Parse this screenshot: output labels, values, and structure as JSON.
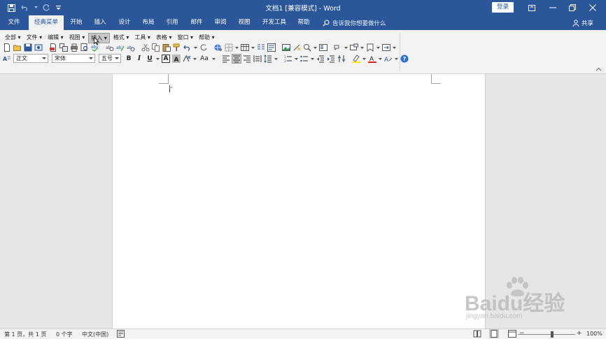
{
  "window": {
    "title": "文档1 [兼容模式] - Word",
    "login_label": "登录"
  },
  "tabs": [
    {
      "label": "文件"
    },
    {
      "label": "经典菜单"
    },
    {
      "label": "开始"
    },
    {
      "label": "插入"
    },
    {
      "label": "设计"
    },
    {
      "label": "布局"
    },
    {
      "label": "引用"
    },
    {
      "label": "邮件"
    },
    {
      "label": "审阅"
    },
    {
      "label": "视图"
    },
    {
      "label": "开发工具"
    },
    {
      "label": "帮助"
    }
  ],
  "tell_me": {
    "placeholder": "告诉我你想要做什么"
  },
  "share_label": "共享",
  "classic_menu": [
    {
      "label": "全部 ▾"
    },
    {
      "label": "文件 ▾"
    },
    {
      "label": "编辑 ▾"
    },
    {
      "label": "视图 ▾"
    },
    {
      "label": "插入 ▾"
    },
    {
      "label": "格式 ▾"
    },
    {
      "label": "工具 ▾"
    },
    {
      "label": "表格 ▾"
    },
    {
      "label": "窗口 ▾"
    },
    {
      "label": "帮助 ▾"
    }
  ],
  "format_bar": {
    "style_value": "正文",
    "font_value": "宋体",
    "size_value": "五号",
    "bold": "B",
    "italic": "I",
    "underline": "U",
    "char_border": "A",
    "change_case": "Aa"
  },
  "status": {
    "page": "第 1 页，共 1 页",
    "words": "0 个字",
    "language": "中文(中国)",
    "zoom": "100%"
  },
  "watermark": {
    "brand": "Baidu经验",
    "url": "jingyan.baidu.com"
  },
  "colors": {
    "word_blue": "#2b579a",
    "ribbon_bg": "#f3f3f3",
    "canvas_bg": "#e6e6e6"
  }
}
